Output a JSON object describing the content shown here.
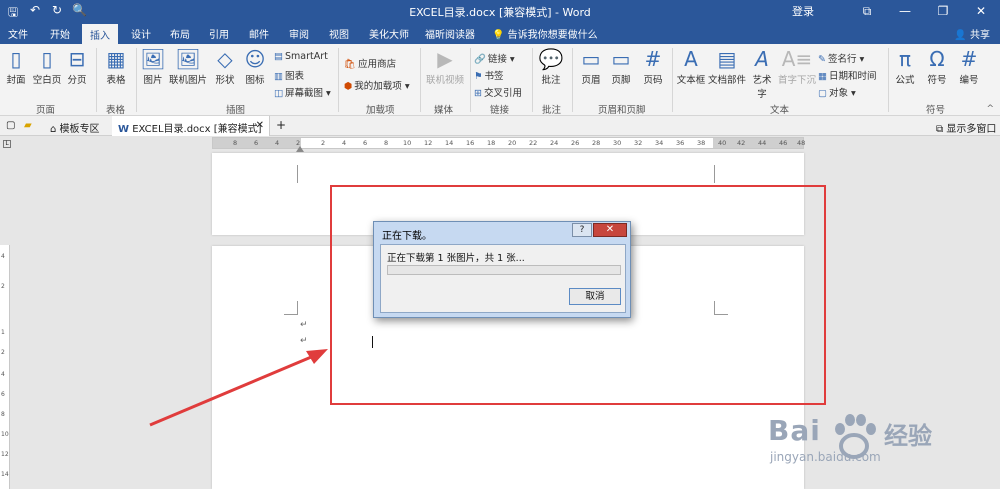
{
  "titlebar": {
    "title": "EXCEL目录.docx [兼容模式] - Word",
    "login": "登录",
    "quick_access": {
      "save": "🖫",
      "undo": "↶",
      "redo": "↻",
      "preview": "🔍"
    }
  },
  "tabs": [
    "文件",
    "开始",
    "插入",
    "设计",
    "布局",
    "引用",
    "邮件",
    "审阅",
    "视图",
    "美化大师",
    "福昕阅读器"
  ],
  "tell_me": "告诉我你想要做什么",
  "share": "共享",
  "ribbon": {
    "cover": "封面",
    "blank_page": "空白页",
    "page_break": "分页",
    "group_pages": "页面",
    "table": "表格",
    "group_table": "表格",
    "picture": "图片",
    "online_picture": "联机图片",
    "shapes": "形状",
    "icons": "图标",
    "smartart": "SmartArt",
    "chart": "图表",
    "screenshot": "屏幕截图",
    "group_illustrations": "插图",
    "store": "应用商店",
    "my_addins": "我的加载项",
    "group_addins": "加载项",
    "online_video": "联机视频",
    "group_media": "媒体",
    "link": "链接",
    "bookmark": "书签",
    "cross_ref": "交叉引用",
    "group_links": "链接",
    "comment": "批注",
    "group_comments": "批注",
    "header": "页眉",
    "footer": "页脚",
    "page_number": "页码",
    "group_hf": "页眉和页脚",
    "textbox": "文本框",
    "quick_parts": "文档部件",
    "wordart": "艺术字",
    "dropcap": "首字下沉",
    "signature_line": "签名行",
    "date_time": "日期和时间",
    "object": "对象",
    "group_text": "文本",
    "equation": "公式",
    "symbol": "符号",
    "numbering": "编号",
    "group_symbols": "符号"
  },
  "doc_tabs": {
    "template_zone": "模板专区",
    "doc_name": "EXCEL目录.docx [兼容模式]",
    "add_tab": "+",
    "multi_window": "显示多窗口"
  },
  "ruler_numbers": [
    "8",
    "6",
    "4",
    "2",
    "2",
    "4",
    "6",
    "8",
    "10",
    "12",
    "14",
    "16",
    "18",
    "20",
    "22",
    "24",
    "26",
    "28",
    "30",
    "32",
    "34",
    "36",
    "38",
    "40",
    "42",
    "44",
    "46",
    "48"
  ],
  "vruler_numbers": [
    "4",
    "2",
    "1",
    "2",
    "4",
    "6",
    "8",
    "10",
    "12",
    "14"
  ],
  "dialog": {
    "title": "正在下载。",
    "message": "正在下载第 1 张图片，共 1 张...",
    "progress": 0,
    "help": "?",
    "close": "✕",
    "cancel": "取消"
  },
  "watermark": {
    "brand": "Bai",
    "brand_cn": "经验",
    "site": "jingyan.baidu.com"
  },
  "colors": {
    "accent": "#2b579a",
    "annotation_red": "#e03c3c",
    "progress": "#3cbf4a"
  }
}
